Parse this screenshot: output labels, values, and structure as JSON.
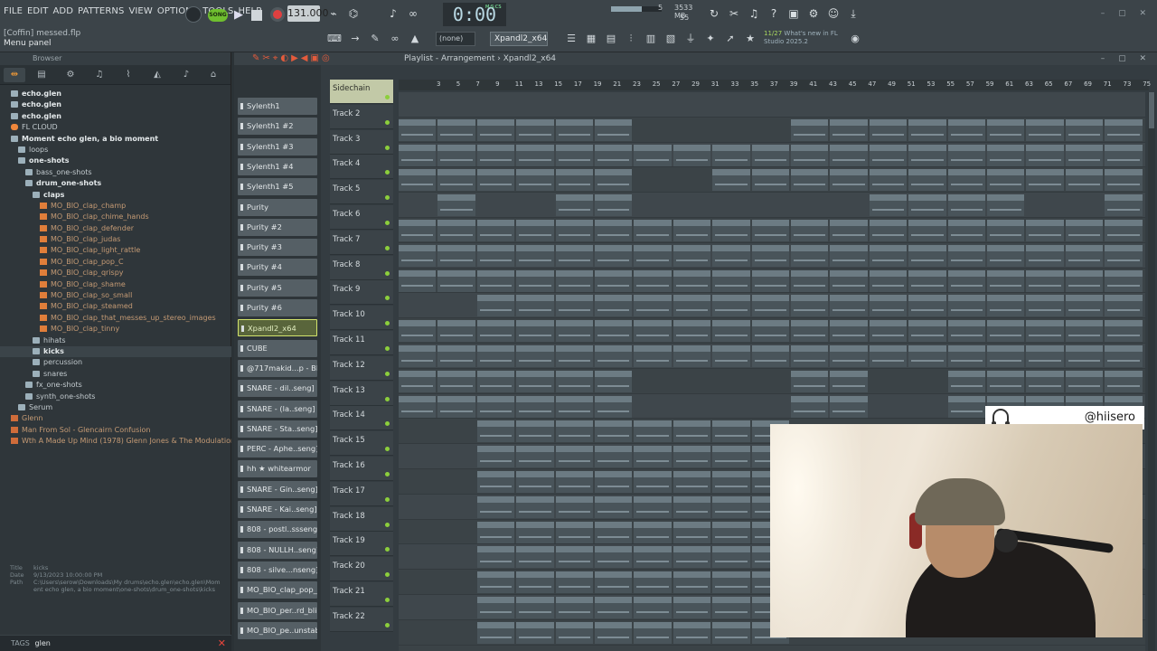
{
  "menu": [
    "FILE",
    "EDIT",
    "ADD",
    "PATTERNS",
    "VIEW",
    "OPTIONS",
    "TOOLS",
    "HELP"
  ],
  "project": {
    "title": "[Coffin] messed.flp",
    "hint": "Menu panel"
  },
  "transport": {
    "mode": "SONG",
    "tempo": "131.000",
    "time": "0:00",
    "time_unit": "M:S:CS"
  },
  "cpu": {
    "memory": "3533 MB",
    "value1": "5",
    "value2": "55"
  },
  "toolbar": {
    "snap": "(none)",
    "pattern": "Xpandl2_x64"
  },
  "news": {
    "date": "11/27",
    "text": "What's new in FL",
    "product": "Studio 2025.2"
  },
  "browser": {
    "title": "Browser",
    "tree": [
      {
        "label": "echo.glen",
        "kind": "folder",
        "indent": 1,
        "style": "bold"
      },
      {
        "label": "echo.glen",
        "kind": "folder",
        "indent": 1,
        "style": "bold"
      },
      {
        "label": "echo.glen",
        "kind": "folder",
        "indent": 1,
        "style": "bold"
      },
      {
        "label": "FL CLOUD",
        "kind": "cloud",
        "indent": 1,
        "style": "cloud"
      },
      {
        "label": "Moment echo glen, a bio moment",
        "kind": "folder",
        "indent": 1,
        "style": "bold"
      },
      {
        "label": "loops",
        "kind": "folder",
        "indent": 2,
        "style": ""
      },
      {
        "label": "one-shots",
        "kind": "folder",
        "indent": 2,
        "style": "bold"
      },
      {
        "label": "bass_one-shots",
        "kind": "folder",
        "indent": 3,
        "style": ""
      },
      {
        "label": "drum_one-shots",
        "kind": "folder",
        "indent": 3,
        "style": "bold"
      },
      {
        "label": "claps",
        "kind": "folder",
        "indent": 4,
        "style": "bold"
      },
      {
        "label": "MO_BIO_clap_champ",
        "kind": "file",
        "indent": 5,
        "style": "file"
      },
      {
        "label": "MO_BIO_clap_chime_hands",
        "kind": "file",
        "indent": 5,
        "style": "file"
      },
      {
        "label": "MO_BIO_clap_defender",
        "kind": "file",
        "indent": 5,
        "style": "file"
      },
      {
        "label": "MO_BIO_clap_judas",
        "kind": "file",
        "indent": 5,
        "style": "file"
      },
      {
        "label": "MO_BIO_clap_light_rattle",
        "kind": "file",
        "indent": 5,
        "style": "file"
      },
      {
        "label": "MO_BIO_clap_pop_C",
        "kind": "file",
        "indent": 5,
        "style": "file"
      },
      {
        "label": "MO_BIO_clap_qrispy",
        "kind": "file",
        "indent": 5,
        "style": "file"
      },
      {
        "label": "MO_BIO_clap_shame",
        "kind": "file",
        "indent": 5,
        "style": "file"
      },
      {
        "label": "MO_BIO_clap_so_small",
        "kind": "file",
        "indent": 5,
        "style": "file"
      },
      {
        "label": "MO_BIO_clap_steamed",
        "kind": "file",
        "indent": 5,
        "style": "file"
      },
      {
        "label": "MO_BIO_clap_that_messes_up_stereo_images",
        "kind": "file",
        "indent": 5,
        "style": "file"
      },
      {
        "label": "MO_BIO_clap_tinny",
        "kind": "file",
        "indent": 5,
        "style": "file"
      },
      {
        "label": "hihats",
        "kind": "folder",
        "indent": 4,
        "style": ""
      },
      {
        "label": "kicks",
        "kind": "folder",
        "indent": 4,
        "style": "bold sel"
      },
      {
        "label": "percussion",
        "kind": "folder",
        "indent": 4,
        "style": ""
      },
      {
        "label": "snares",
        "kind": "folder",
        "indent": 4,
        "style": ""
      },
      {
        "label": "fx_one-shots",
        "kind": "folder",
        "indent": 3,
        "style": ""
      },
      {
        "label": "synth_one-shots",
        "kind": "folder",
        "indent": 3,
        "style": ""
      },
      {
        "label": "Serum",
        "kind": "folder",
        "indent": 2,
        "style": ""
      },
      {
        "label": "Glenn",
        "kind": "song",
        "indent": 1,
        "style": "file"
      },
      {
        "label": "Man From Sol - Glencairn Confusion",
        "kind": "song",
        "indent": 1,
        "style": "file"
      },
      {
        "label": "Wth A Made Up Mind (1978) Glenn Jones & The Modulations",
        "kind": "song",
        "indent": 1,
        "style": "file"
      }
    ],
    "info": {
      "title_label": "Title",
      "title": "kicks",
      "date_label": "Date",
      "date": "9/13/2023 10:00:00 PM",
      "path_label": "Path",
      "path": "C:\\Users\\serow\\Downloads\\My drums\\echo.glen\\echo.glen\\Moment echo glen, a bio moment\\one-shots\\drum_one-shots\\kicks"
    },
    "tags_label": "TAGS",
    "tags_value": "glen"
  },
  "playlist": {
    "title": "Playlist - Arrangement",
    "pattern": "Xpandl2_x64",
    "patterns": [
      "Sylenth1",
      "Sylenth1 #2",
      "Sylenth1 #3",
      "Sylenth1 #4",
      "Sylenth1 #5",
      "Purity",
      "Purity #2",
      "Purity #3",
      "Purity #4",
      "Purity #5",
      "Purity #6",
      "Xpandl2_x64",
      "CUBE",
      "@717makid...p - BRIGHT",
      "SNARE - dil..seng] (K4L)",
      "SNARE - (la..seng] (K4L)",
      "SNARE - Sta..seng] (K4L)",
      "PERC - Aphe..seng] (K4L)",
      "hh ★ whitearmor",
      "SNARE - Gin..seng] (K4L)",
      "SNARE - Kai..seng] (K4L)",
      "808 - postl..ssseng] (K4L)",
      "808 - NULLH..seng] (K4L)",
      "808 - silve...nseng] (K4L)",
      "MO_BIO_clap_pop_C",
      "MO_BIO_per..rd_blink_E",
      "MO_BIO_pe..unstable_B"
    ],
    "tracks": [
      "Sidechain",
      "Track 2",
      "Track 3",
      "Track 4",
      "Track 5",
      "Track 6",
      "Track 7",
      "Track 8",
      "Track 9",
      "Track 10",
      "Track 11",
      "Track 12",
      "Track 13",
      "Track 14",
      "Track 15",
      "Track 16",
      "Track 17",
      "Track 18",
      "Track 19",
      "Track 20",
      "Track 21",
      "Track 22"
    ],
    "ruler": [
      "3",
      "5",
      "7",
      "9",
      "11",
      "13",
      "15",
      "17",
      "19",
      "21",
      "23",
      "25",
      "27",
      "29",
      "31",
      "33",
      "35",
      "37",
      "39",
      "41",
      "43",
      "45",
      "47",
      "49",
      "51",
      "53",
      "55",
      "57",
      "59",
      "61",
      "63",
      "65",
      "67",
      "69",
      "71",
      "73",
      "75"
    ],
    "lanes": [
      {
        "label": "",
        "ranges": []
      },
      {
        "label": "Sylenth1",
        "ranges": [
          [
            0,
            12
          ],
          [
            20,
            38
          ]
        ]
      },
      {
        "label": "Syle..h1 #2",
        "ranges": [
          [
            0,
            38
          ]
        ]
      },
      {
        "label": "Syle..h1 #3",
        "ranges": [
          [
            0,
            12
          ],
          [
            16,
            38
          ]
        ]
      },
      {
        "label": "Syle..h1 #4",
        "ranges": [
          [
            2,
            4
          ],
          [
            8,
            12
          ],
          [
            24,
            32
          ],
          [
            36,
            38
          ]
        ]
      },
      {
        "label": "Syle..h1 #5",
        "ranges": [
          [
            0,
            38
          ]
        ]
      },
      {
        "label": "Purity",
        "ranges": [
          [
            0,
            38
          ]
        ]
      },
      {
        "label": "Pur..#2",
        "ranges": [
          [
            0,
            38
          ]
        ]
      },
      {
        "label": "Purity #3",
        "ranges": [
          [
            4,
            38
          ]
        ]
      },
      {
        "label": "",
        "ranges": [
          [
            0,
            38
          ]
        ]
      },
      {
        "label": "Purity #5",
        "ranges": [
          [
            0,
            38
          ]
        ]
      },
      {
        "label": "Purity #6",
        "ranges": [
          [
            0,
            12
          ],
          [
            20,
            24
          ],
          [
            28,
            38
          ]
        ]
      },
      {
        "label": "Xpa..._x64",
        "ranges": [
          [
            0,
            12
          ],
          [
            20,
            24
          ],
          [
            28,
            38
          ]
        ]
      },
      {
        "label": "CUBE",
        "ranges": [
          [
            4,
            19
          ]
        ]
      },
      {
        "label": "",
        "ranges": [
          [
            4,
            19
          ]
        ]
      },
      {
        "label": "",
        "ranges": [
          [
            4,
            19
          ]
        ]
      },
      {
        "label": "",
        "ranges": [
          [
            4,
            19
          ]
        ]
      },
      {
        "label": "SNAR..(K4L)",
        "ranges": [
          [
            4,
            19
          ]
        ]
      },
      {
        "label": "",
        "ranges": [
          [
            4,
            19
          ]
        ]
      },
      {
        "label": "hh..armor",
        "ranges": [
          [
            4,
            19
          ]
        ]
      },
      {
        "label": "",
        "ranges": [
          [
            4,
            19
          ]
        ]
      },
      {
        "label": "SNA..(K4L)",
        "ranges": [
          [
            4,
            19
          ]
        ]
      }
    ]
  },
  "overlay": {
    "handle": "@hiisero"
  },
  "colors": {
    "accent_orange": "#f19a38",
    "clip": "#6c7b83",
    "selected_pattern": "#d2e36c",
    "record": "#e04040"
  }
}
